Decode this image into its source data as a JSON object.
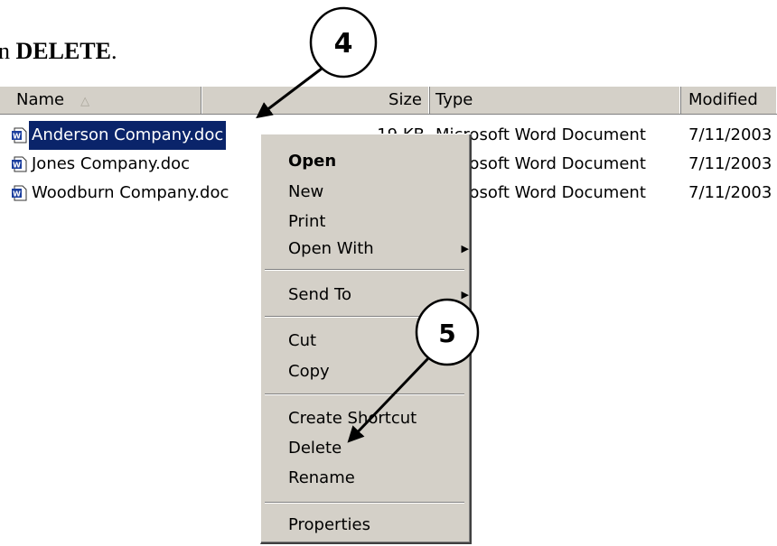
{
  "instruction": {
    "prefix": "n ",
    "bold": "DELETE",
    "suffix": "."
  },
  "columns": {
    "name": "Name",
    "size": "Size",
    "type": "Type",
    "modified": "Modified"
  },
  "files": [
    {
      "name": "Anderson Company.doc",
      "size": "19 KB",
      "type": "Microsoft Word Document",
      "modified": "7/11/2003"
    },
    {
      "name": "Jones Company.doc",
      "size": "",
      "type": "Microsoft Word Document",
      "modified": "7/11/2003"
    },
    {
      "name": "Woodburn Company.doc",
      "size": "",
      "type": "Microsoft Word Document",
      "modified": "7/11/2003"
    }
  ],
  "context_menu": {
    "open": "Open",
    "new": "New",
    "print": "Print",
    "open_with": "Open With",
    "send_to": "Send To",
    "cut": "Cut",
    "copy": "Copy",
    "create_shortcut": "Create Shortcut",
    "delete": "Delete",
    "rename": "Rename",
    "properties": "Properties"
  },
  "callouts": {
    "step4": "4",
    "step5": "5"
  },
  "icons": [
    "word-doc-icon",
    "sort-ascending-icon",
    "submenu-arrow-icon"
  ],
  "colors": {
    "selection": "#0a246a",
    "menu_bg": "#d4d0c8",
    "header_bg": "#d4d0c8"
  }
}
